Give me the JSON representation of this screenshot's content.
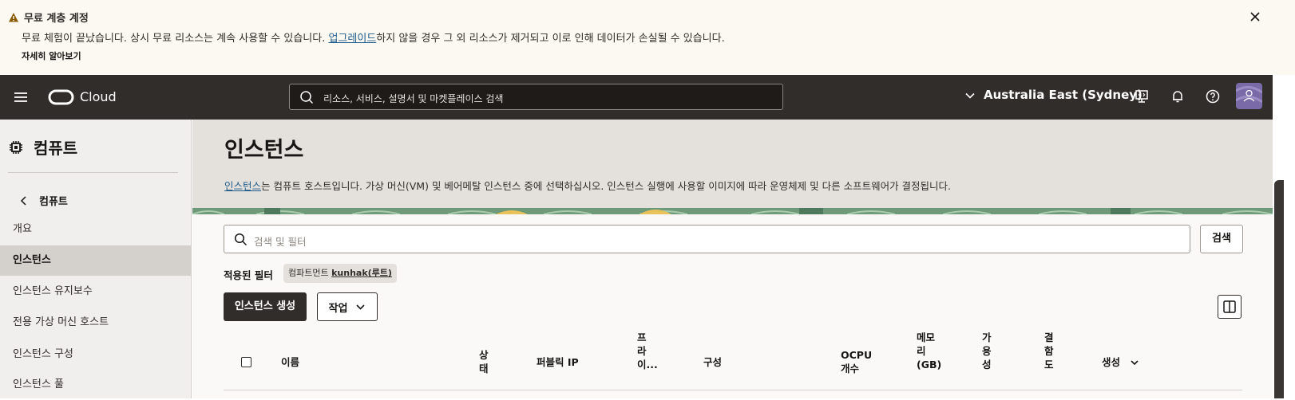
{
  "banner": {
    "title": "무료 계층 계정",
    "message_before": "무료 체험이 끝났습니다. 상시 무료 리소스는 계속 사용할 수 있습니다. ",
    "message_link": "업그레이드",
    "message_after": "하지 않을 경우 그 외 리소스가 제거되고 이로 인해 데이터가 손실될 수 있습니다.",
    "learn_more": "자세히 알아보기"
  },
  "topbar": {
    "brand": "Cloud",
    "search_placeholder": "리소스, 서비스, 설명서 및 마켓플레이스 검색",
    "region": "Australia East (Sydney)"
  },
  "sidebar": {
    "heading": "컴퓨트",
    "back_label": "컴퓨트",
    "items": [
      {
        "label": "개요",
        "active": false
      },
      {
        "label": "인스턴스",
        "active": true
      },
      {
        "label": "인스턴스 유지보수",
        "active": false
      },
      {
        "label": "전용 가상 머신 호스트",
        "active": false
      },
      {
        "label": "인스턴스 구성",
        "active": false
      },
      {
        "label": "인스턴스 풀",
        "active": false
      }
    ]
  },
  "main": {
    "title": "인스턴스",
    "desc_link": "인스턴스",
    "desc_rest": "는 컴퓨트 호스트입니다. 가상 머신(VM) 및 베어메탈 인스턴스 중에 선택하십시오. 인스턴스 실행에 사용할 이미지에 따라 운영체제 및 다른 소프트웨어가 결정됩니다.",
    "filter_placeholder": "검색 및 필터",
    "search_button": "검색",
    "applied_filters_label": "적용된 필터",
    "filter_chip_key": "컴파트먼트",
    "filter_chip_value": "kunhak(루트)",
    "create_button": "인스턴스 생성",
    "actions_button": "작업",
    "columns": [
      "이름",
      "상\n태",
      "퍼블릭 IP",
      "프\n라\n이...",
      "구성",
      "OCPU\n개수",
      "메모\n리\n(GB)",
      "가\n용\n성",
      "결\n함\n도",
      "생성"
    ]
  },
  "colors": {
    "topbar": "#312d2a",
    "banner": "#fcf8f2",
    "link": "#1f5c8b",
    "sidebar": "#f1efed",
    "header": "#e4e1dd"
  }
}
